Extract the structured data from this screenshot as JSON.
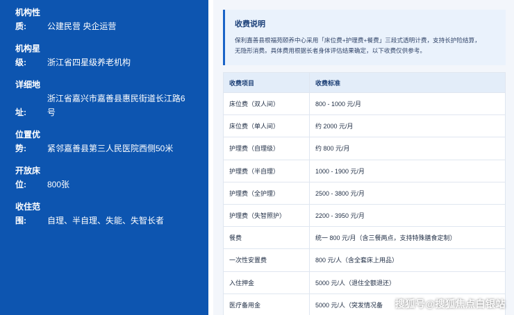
{
  "sidebar": {
    "items": [
      {
        "label_a": "机构性",
        "label_b": "质:",
        "value": "公建民营 央企运营"
      },
      {
        "label_a": "机构星",
        "label_b": "级:",
        "value": "浙江省四星级养老机构"
      },
      {
        "label_a": "详细地",
        "label_b": "址:",
        "value": "浙江省嘉兴市嘉善县惠民街道长江路6号"
      },
      {
        "label_a": "位置优",
        "label_b": "势:",
        "value": "紧邻嘉善县第三人民医院西侧50米"
      },
      {
        "label_a": "开放床",
        "label_b": "位:",
        "value": "800张"
      },
      {
        "label_a": "收住范",
        "label_b": "围:",
        "value": "自理、半自理、失能、失智长者"
      }
    ]
  },
  "notice": {
    "title": "收费说明",
    "line1": "保利嘉善县根福苑颐养中心采用「床位费+护理费+餐费」三段式透明计费，支持长护险结算，",
    "line2": "无隐形消费。具体费用根据长者身体评估结果确定，以下收费仅供参考。"
  },
  "table": {
    "headers": [
      "收费项目",
      "收费标准"
    ],
    "rows": [
      [
        "床位费（双人间）",
        "800 - 1000 元/月"
      ],
      [
        "床位费（单人间）",
        "约 2000 元/月"
      ],
      [
        "护理费（自理级）",
        "约 800 元/月"
      ],
      [
        "护理费（半自理）",
        "1000 - 1900 元/月"
      ],
      [
        "护理费（全护理）",
        "2500 - 3800 元/月"
      ],
      [
        "护理费（失智照护）",
        "2200 - 3950 元/月"
      ],
      [
        "餐费",
        "统一 800 元/月（含三餐两点，支持特殊膳食定制）"
      ],
      [
        "一次性安置费",
        "800 元/人（含全套床上用品）"
      ],
      [
        "入住押金",
        "5000 元/人（退住全额退还）"
      ],
      [
        "医疗备用金",
        "5000 元/人（突发情况备"
      ]
    ]
  },
  "watermark": "搜狐号@搜狐焦点白银站"
}
